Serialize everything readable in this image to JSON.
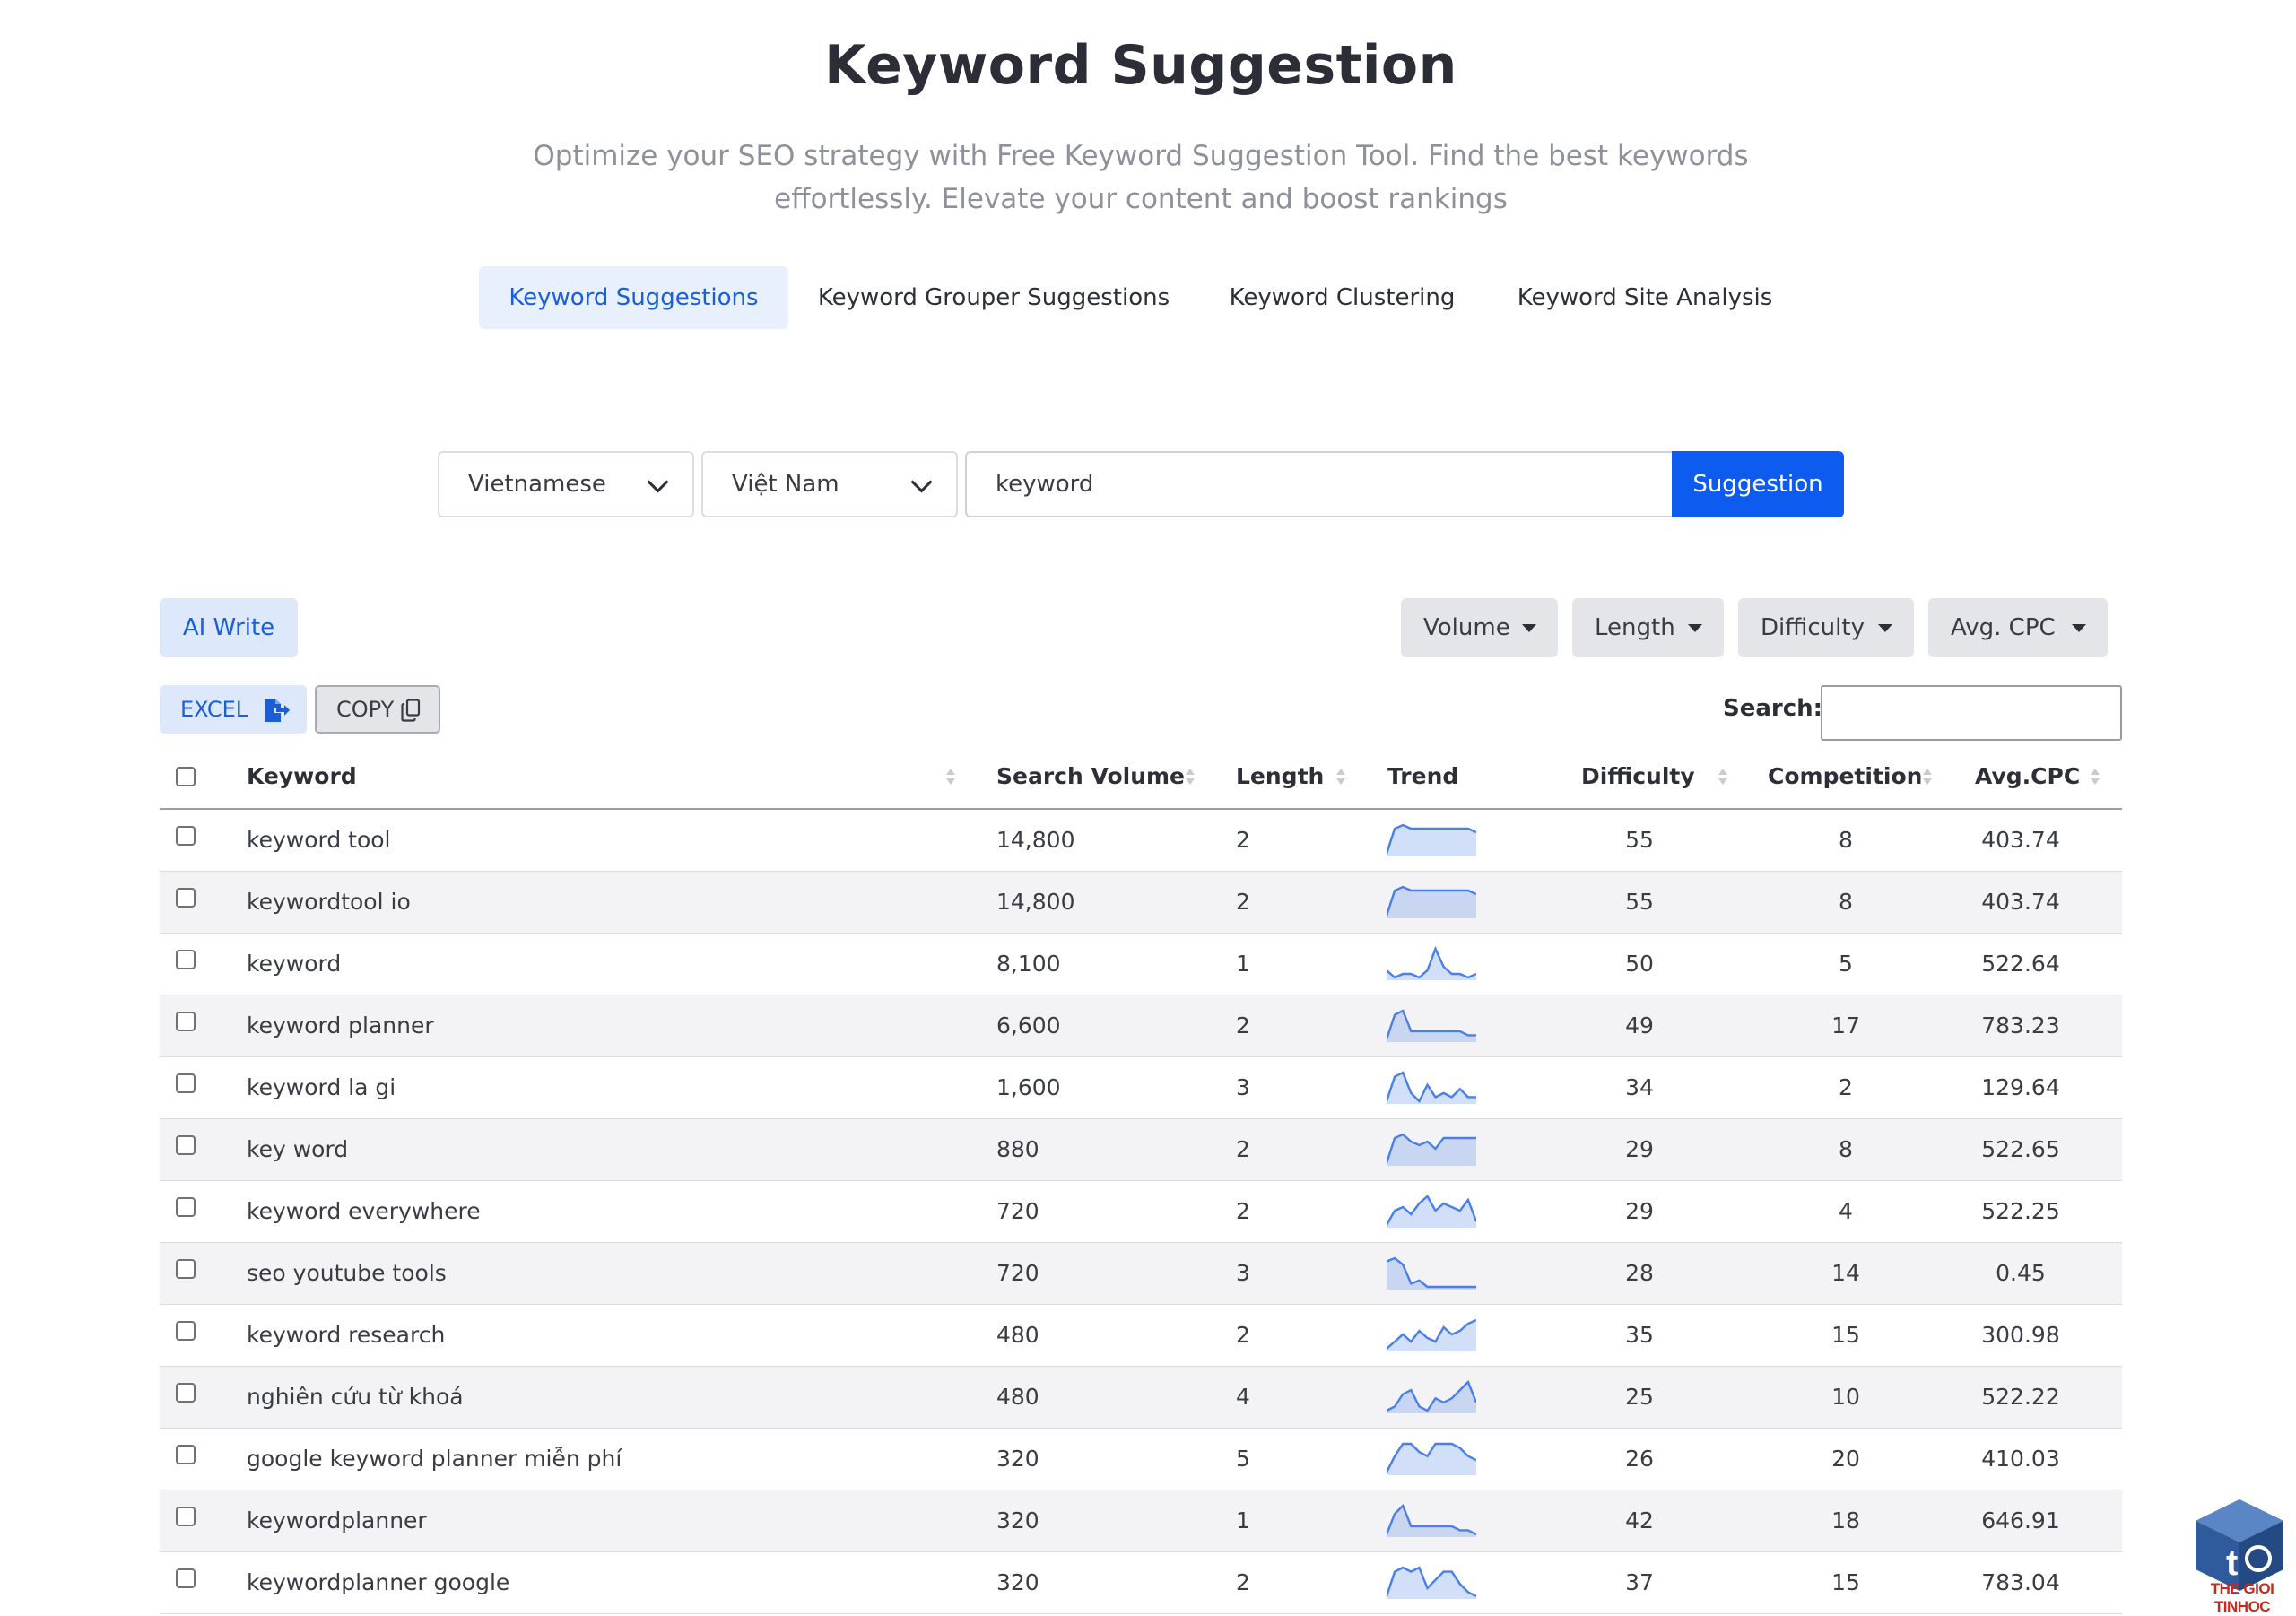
{
  "header": {
    "title": "Keyword Suggestion",
    "subtitle": "Optimize your SEO strategy with Free Keyword Suggestion Tool. Find the best keywords effortlessly. Elevate your content and boost rankings"
  },
  "tabs": [
    {
      "label": "Keyword Suggestions",
      "active": true
    },
    {
      "label": "Keyword Grouper Suggestions",
      "active": false
    },
    {
      "label": "Keyword Clustering",
      "active": false
    },
    {
      "label": "Keyword Site Analysis",
      "active": false
    }
  ],
  "search_form": {
    "language": "Vietnamese",
    "country": "Việt Nam",
    "keyword_value": "keyword",
    "submit_label": "Suggestion"
  },
  "toolbar": {
    "ai_write": "AI Write",
    "filters": [
      "Volume",
      "Length",
      "Difficulty",
      "Avg. CPC"
    ],
    "excel": "EXCEL",
    "copy": "COPY",
    "search_label": "Search:"
  },
  "table": {
    "columns": [
      "Keyword",
      "Search Volume",
      "Length",
      "Trend",
      "Difficulty",
      "Competition",
      "Avg.CPC"
    ],
    "trend_color": "#4a7fe8",
    "rows": [
      {
        "keyword": "keyword tool",
        "volume": "14,800",
        "length": "2",
        "difficulty": "55",
        "competition": "8",
        "cpc": "403.74",
        "trend": [
          2,
          9,
          10,
          9,
          9,
          9,
          9,
          9,
          9,
          9,
          9,
          8
        ]
      },
      {
        "keyword": "keywordtool io",
        "volume": "14,800",
        "length": "2",
        "difficulty": "55",
        "competition": "8",
        "cpc": "403.74",
        "trend": [
          2,
          9,
          10,
          9,
          9,
          9,
          9,
          9,
          9,
          9,
          9,
          8
        ]
      },
      {
        "keyword": "keyword",
        "volume": "8,100",
        "length": "1",
        "difficulty": "50",
        "competition": "5",
        "cpc": "522.64",
        "trend": [
          4,
          2,
          3,
          3,
          2,
          4,
          10,
          5,
          3,
          3,
          2,
          3
        ]
      },
      {
        "keyword": "keyword planner",
        "volume": "6,600",
        "length": "2",
        "difficulty": "49",
        "competition": "17",
        "cpc": "783.23",
        "trend": [
          3,
          9,
          10,
          5,
          5,
          5,
          5,
          5,
          5,
          5,
          4,
          4
        ]
      },
      {
        "keyword": "keyword la gi",
        "volume": "1,600",
        "length": "3",
        "difficulty": "34",
        "competition": "2",
        "cpc": "129.64",
        "trend": [
          3,
          9,
          10,
          5,
          3,
          7,
          4,
          5,
          4,
          6,
          4,
          4
        ]
      },
      {
        "keyword": "key word",
        "volume": "880",
        "length": "2",
        "difficulty": "29",
        "competition": "8",
        "cpc": "522.65",
        "trend": [
          2,
          9,
          10,
          8,
          7,
          8,
          6,
          9,
          9,
          9,
          9,
          9
        ]
      },
      {
        "keyword": "keyword everywhere",
        "volume": "720",
        "length": "2",
        "difficulty": "29",
        "competition": "4",
        "cpc": "522.25",
        "trend": [
          2,
          6,
          7,
          5,
          8,
          10,
          6,
          8,
          7,
          6,
          9,
          3
        ]
      },
      {
        "keyword": "seo youtube tools",
        "volume": "720",
        "length": "3",
        "difficulty": "28",
        "competition": "14",
        "cpc": "0.45",
        "trend": [
          9,
          10,
          8,
          2,
          3,
          1,
          1,
          1,
          1,
          1,
          1,
          1
        ]
      },
      {
        "keyword": "keyword research",
        "volume": "480",
        "length": "2",
        "difficulty": "35",
        "competition": "15",
        "cpc": "300.98",
        "trend": [
          2,
          4,
          6,
          4,
          7,
          5,
          4,
          8,
          6,
          7,
          9,
          10
        ]
      },
      {
        "keyword": "nghiên cứu từ khoá",
        "volume": "480",
        "length": "4",
        "difficulty": "25",
        "competition": "10",
        "cpc": "522.22",
        "trend": [
          3,
          4,
          7,
          8,
          4,
          3,
          6,
          5,
          6,
          8,
          10,
          5
        ]
      },
      {
        "keyword": "google keyword planner miễn phí",
        "volume": "320",
        "length": "5",
        "difficulty": "26",
        "competition": "20",
        "cpc": "410.03",
        "trend": [
          2,
          6,
          9,
          9,
          7,
          6,
          9,
          9,
          9,
          8,
          6,
          5
        ]
      },
      {
        "keyword": "keywordplanner",
        "volume": "320",
        "length": "1",
        "difficulty": "42",
        "competition": "18",
        "cpc": "646.91",
        "trend": [
          3,
          8,
          10,
          5,
          5,
          5,
          5,
          5,
          5,
          4,
          4,
          3
        ]
      },
      {
        "keyword": "keywordplanner google",
        "volume": "320",
        "length": "2",
        "difficulty": "37",
        "competition": "15",
        "cpc": "783.04",
        "trend": [
          2,
          8,
          9,
          8,
          9,
          4,
          6,
          8,
          8,
          5,
          3,
          2
        ]
      }
    ]
  },
  "watermark": {
    "text": "THE GIOI TINHOC",
    "icon": "cube-logo-icon"
  }
}
